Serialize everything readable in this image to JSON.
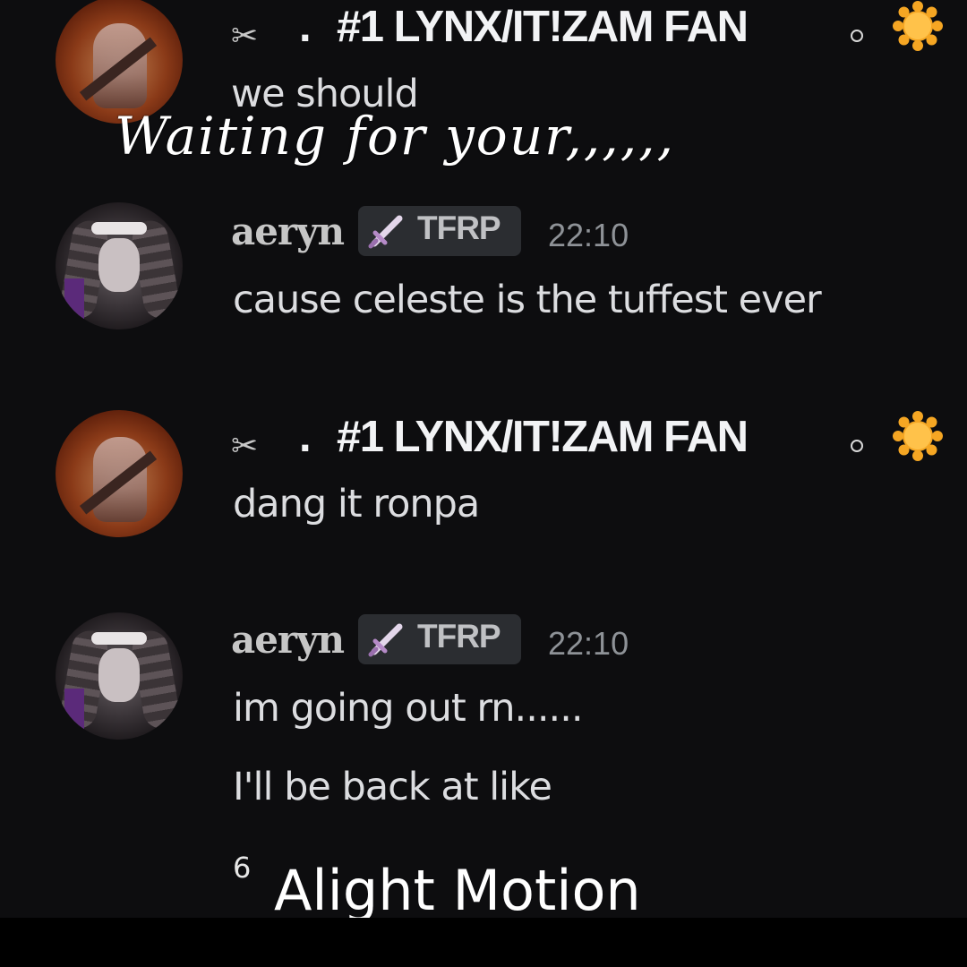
{
  "messages": [
    {
      "author": "#1 LYNX/IT!ZAM FAN",
      "prefix_icon": "scissors-icon",
      "separator": ".",
      "suffix_icons": [
        "small-circle-icon",
        "sun-icon"
      ],
      "avatar": "fire-figure-avatar",
      "lines": [
        "we should"
      ]
    },
    {
      "author": "aeryn",
      "tag": {
        "icon": "sword-icon",
        "label": "TFRP"
      },
      "time": "22:10",
      "avatar": "goth-character-avatar",
      "lines": [
        "cause celeste is the tuffest ever"
      ]
    },
    {
      "author": "#1 LYNX/IT!ZAM FAN",
      "prefix_icon": "scissors-icon",
      "separator": ".",
      "suffix_icons": [
        "small-circle-icon",
        "sun-icon"
      ],
      "avatar": "fire-figure-avatar",
      "lines": [
        "dang it ronpa"
      ]
    },
    {
      "author": "aeryn",
      "tag": {
        "icon": "sword-icon",
        "label": "TFRP"
      },
      "time": "22:10",
      "avatar": "goth-character-avatar",
      "lines": [
        "im going out rn......",
        "I'll be back at like"
      ]
    }
  ],
  "overlay_caption": "Waiting for your,,,,,,",
  "partial_counter": "6",
  "watermark": "Alight Motion",
  "colors": {
    "background": "#0d0d0f",
    "username_bright": "#f2f3f5",
    "username_aeryn": "#c6c6c6",
    "message_text": "#dcdde0",
    "timestamp": "#8e9297",
    "tag_bg": "#2b2d31",
    "sun": "#f5a623"
  }
}
